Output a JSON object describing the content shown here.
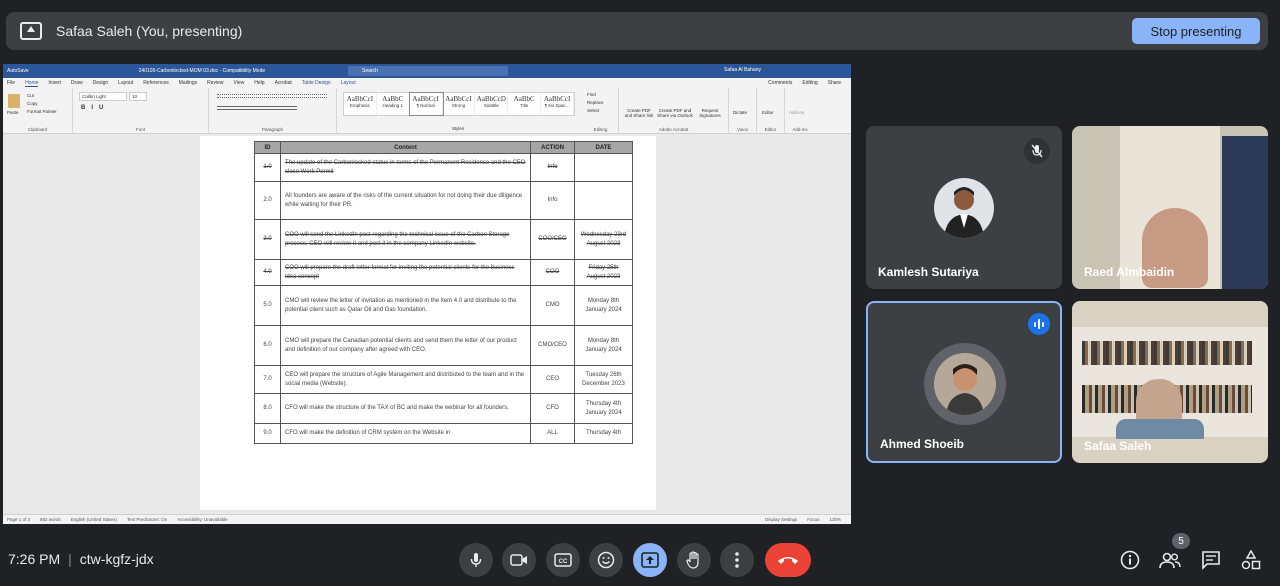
{
  "banner": {
    "presenter_label": "Safaa Saleh (You, presenting)",
    "stop_label": "Stop presenting"
  },
  "word": {
    "autosave": "AutoSave",
    "filename": "240105-Carbonlocked-MOM 03.doc - Compatibility Mode",
    "search": "Search",
    "user": "Safaa Al Bahany",
    "menu": [
      "File",
      "Home",
      "Insert",
      "Draw",
      "Design",
      "Layout",
      "References",
      "Mailings",
      "Review",
      "View",
      "Help",
      "Acrobat",
      "Table Design",
      "Layout"
    ],
    "comments": "Comments",
    "editing": "Editing",
    "share": "Share",
    "font": "Calibri Light",
    "font_size": "10",
    "paste": "Paste",
    "cut": "Cut",
    "copy": "Copy",
    "format_painter": "Format Painter",
    "groups": {
      "clipboard": "Clipboard",
      "font": "Font",
      "paragraph": "Paragraph",
      "styles": "Styles",
      "editing": "Editing",
      "adobe": "Adobe Acrobat",
      "voice": "Voice",
      "editor": "Editor",
      "addins": "Add-ins"
    },
    "style_names": [
      "Emphasis",
      "Heading 1",
      "¶ Normal",
      "Strong",
      "Subtitle",
      "Title",
      "¶ No Spac..."
    ],
    "find": "Find",
    "replace": "Replace",
    "select": "Select",
    "acrobat_btns": [
      "Create PDF and Share link",
      "Create PDF and Share via Outlook",
      "Request Signatures"
    ],
    "dictate": "Dictate",
    "editor_btn": "Editor",
    "addins_btn": "Add-ins",
    "status": [
      "Page 1 of 3",
      "882 words",
      "English (United States)",
      "Text Predictions: On",
      "Accessibility: Unavailable"
    ],
    "display_settings": "Display Settings",
    "focus": "Focus",
    "zoom": "130%"
  },
  "table": {
    "headers": [
      "ID",
      "Content",
      "ACTION",
      "DATE"
    ],
    "rows": [
      {
        "id": "1.0",
        "content": "The update of the Carbonlocked status in terms of the Permanent Residence and the CEO close Work Permit",
        "action": "Info",
        "date": "",
        "done": true
      },
      {
        "id": "2.0",
        "content": "All founders are aware of the risks of the current situation for not doing their due diligence while waiting for their PR.",
        "action": "Info",
        "date": "",
        "done": false
      },
      {
        "id": "3.0",
        "content": "COO will send the LinkedIn post regarding the technical issue of the Carbon Storage process; CEO will review it and post it in the company LinkedIn website.",
        "action": "COO/CEO",
        "date": "Wednesday 23rd August 2023",
        "done": true
      },
      {
        "id": "4.0",
        "content": "COO will prepare the draft letter format for inviting the potential clients for the business idea concept",
        "action": "COO",
        "date": "Friday 25th August 2023",
        "done": true
      },
      {
        "id": "5.0",
        "content": "CMO will review the letter of invitation as mentioned in the item 4.0 and distribute to the potential client such as Qatar Oil and Gas foundation.",
        "action": "CMO",
        "date": "Monday 8th January 2024",
        "done": false
      },
      {
        "id": "6.0",
        "content": "CMO will prepare the Canadian potential clients and send them the letter of our product and definition of our company after agreed with CEO.",
        "action": "CMO/CEO",
        "date": "Monday 8th January 2024",
        "done": false
      },
      {
        "id": "7.0",
        "content": "CEO will prepare the structure of Agile Management and distributed to the team and in the social media (Website).",
        "action": "CEO",
        "date": "Tuesday 26th December 2023",
        "done": false
      },
      {
        "id": "8.0",
        "content": "CFO will make the structure of the TAX of BC and make the webinar for all founders.",
        "action": "CFO",
        "date": "Thursday 4th January 2024",
        "done": false
      },
      {
        "id": "9.0",
        "content": "CFO will make the definition of CRM system on the Website in",
        "action": "ALL",
        "date": "Thursday 4th",
        "done": false
      }
    ]
  },
  "participants": [
    {
      "name": "Kamlesh Sutariya",
      "muted": true
    },
    {
      "name": "Raed Almbaidin",
      "muted": false
    },
    {
      "name": "Ahmed Shoeib",
      "speaking": true
    },
    {
      "name": "Safaa Saleh",
      "muted": false
    }
  ],
  "bottom": {
    "time": "7:26 PM",
    "meeting_code": "ctw-kgfz-jdx",
    "people_count": "5"
  },
  "colors": {
    "stop_button": "#8ab4f8",
    "hangup": "#ea4335",
    "active_border": "#8ab4f8",
    "word_blue": "#2b579a"
  }
}
